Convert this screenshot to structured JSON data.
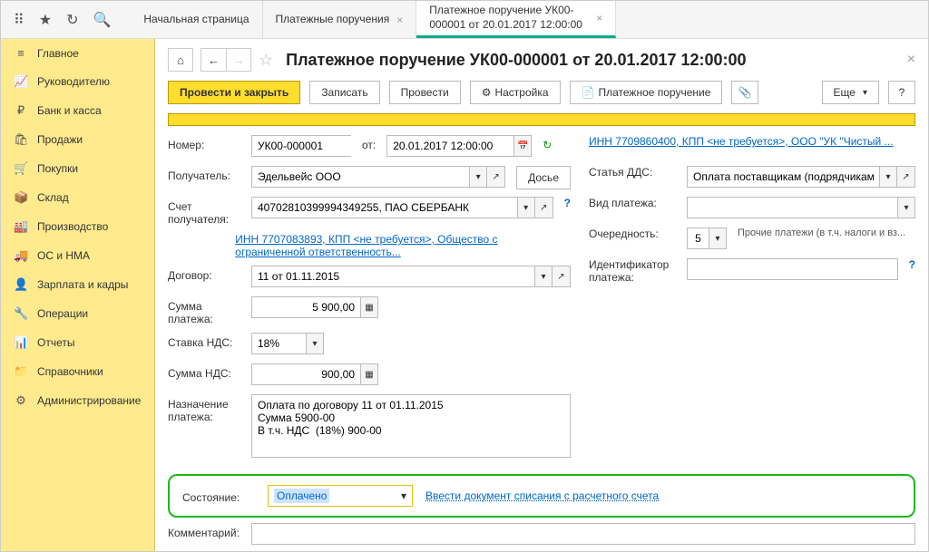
{
  "topbar": {
    "tabs": [
      {
        "label": "Начальная страница"
      },
      {
        "label": "Платежные поручения"
      },
      {
        "label": "Платежное поручение УК00-000001 от 20.01.2017 12:00:00"
      }
    ]
  },
  "sidebar": {
    "items": [
      {
        "label": "Главное",
        "icon": "≡"
      },
      {
        "label": "Руководителю",
        "icon": "📈"
      },
      {
        "label": "Банк и касса",
        "icon": "₽"
      },
      {
        "label": "Продажи",
        "icon": "🛍"
      },
      {
        "label": "Покупки",
        "icon": "🛒"
      },
      {
        "label": "Склад",
        "icon": "📦"
      },
      {
        "label": "Производство",
        "icon": "🏭"
      },
      {
        "label": "ОС и НМА",
        "icon": "🚚"
      },
      {
        "label": "Зарплата и кадры",
        "icon": "👤"
      },
      {
        "label": "Операции",
        "icon": "🔧"
      },
      {
        "label": "Отчеты",
        "icon": "📊"
      },
      {
        "label": "Справочники",
        "icon": "📁"
      },
      {
        "label": "Администрирование",
        "icon": "⚙"
      }
    ]
  },
  "header": {
    "title": "Платежное поручение УК00-000001 от 20.01.2017 12:00:00"
  },
  "toolbar": {
    "post_close": "Провести и закрыть",
    "record": "Записать",
    "post": "Провести",
    "settings": "Настройка",
    "payment_order": "Платежное поручение",
    "more": "Еще",
    "help": "?"
  },
  "form": {
    "number_label": "Номер:",
    "number": "УК00-000001",
    "date_label": "от:",
    "date": "20.01.2017 12:00:00",
    "recipient_label": "Получатель:",
    "recipient": "Эдельвейс ООО",
    "dossier": "Досье",
    "account_label": "Счет получателя:",
    "account": "40702810399994349255, ПАО СБЕРБАНК",
    "inn_link": "ИНН 7707083893, КПП <не требуется>, Общество с ограниченной ответственность...",
    "contract_label": "Договор:",
    "contract": "11 от 01.11.2015",
    "sum_label": "Сумма платежа:",
    "sum": "5 900,00",
    "vat_rate_label": "Ставка НДС:",
    "vat_rate": "18%",
    "vat_sum_label": "Сумма НДС:",
    "vat_sum": "900,00",
    "purpose_label": "Назначение платежа:",
    "purpose": "Оплата по договору 11 от 01.11.2015\nСумма 5900-00\nВ т.ч. НДС  (18%) 900-00",
    "right_inn_link": "ИНН 7709860400, КПП <не требуется>, ООО \"УК \"Чистый ...",
    "dds_label": "Статья ДДС:",
    "dds": "Оплата поставщикам (подрядчикам)",
    "payment_type_label": "Вид платежа:",
    "payment_type": "",
    "priority_label": "Очередность:",
    "priority": "5",
    "priority_hint": "Прочие платежи (в т.ч. налоги и вз...",
    "identifier_label": "Идентификатор платежа:",
    "identifier": "",
    "status_label": "Состояние:",
    "status": "Оплачено",
    "status_link": "Ввести документ списания с расчетного счета",
    "comment_label": "Комментарий:"
  }
}
